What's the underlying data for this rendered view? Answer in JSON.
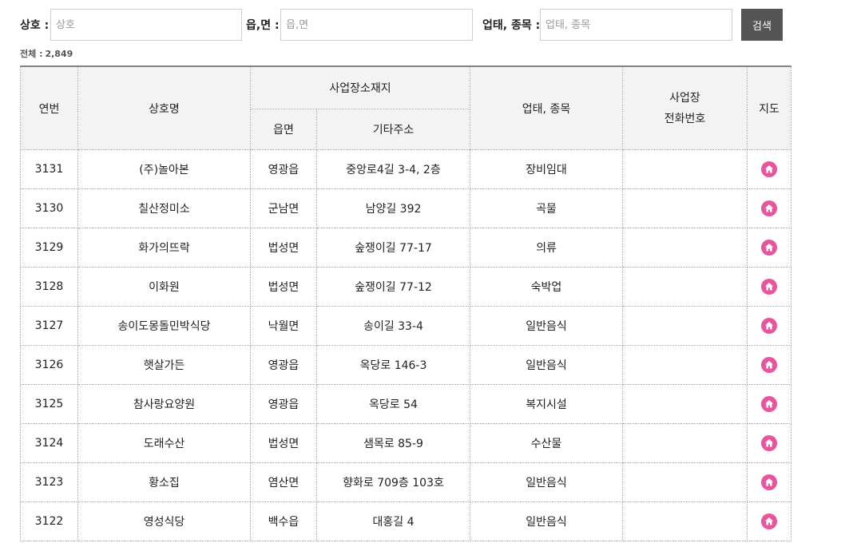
{
  "search": {
    "name_label": "상호 :",
    "name_placeholder": "상호",
    "town_label": "읍,면 :",
    "town_placeholder": "읍,면",
    "type_label": "업태, 종목 :",
    "type_placeholder": "업태, 종목",
    "button_label": "검색"
  },
  "total": {
    "label": "전체 :",
    "count": "2,849"
  },
  "table": {
    "headers": {
      "no": "연번",
      "name": "상호명",
      "location_group": "사업장소재지",
      "town": "읍면",
      "address": "기타주소",
      "type": "업태, 종목",
      "phone_line1": "사업장",
      "phone_line2": "전화번호",
      "map": "지도"
    },
    "rows": [
      {
        "no": "3131",
        "name": "(주)놀아본",
        "town": "영광읍",
        "address": "중앙로4길 3-4, 2층",
        "type": "장비임대",
        "phone": ""
      },
      {
        "no": "3130",
        "name": "칠산정미소",
        "town": "군남면",
        "address": "남양길 392",
        "type": "곡물",
        "phone": ""
      },
      {
        "no": "3129",
        "name": "화가의뜨락",
        "town": "법성면",
        "address": "숲쟁이길 77-17",
        "type": "의류",
        "phone": ""
      },
      {
        "no": "3128",
        "name": "이화원",
        "town": "법성면",
        "address": "숲쟁이길 77-12",
        "type": "숙박업",
        "phone": ""
      },
      {
        "no": "3127",
        "name": "송이도몽돌민박식당",
        "town": "낙월면",
        "address": "송이길 33-4",
        "type": "일반음식",
        "phone": ""
      },
      {
        "no": "3126",
        "name": "햇살가든",
        "town": "영광읍",
        "address": "옥당로 146-3",
        "type": "일반음식",
        "phone": ""
      },
      {
        "no": "3125",
        "name": "참사랑요양원",
        "town": "영광읍",
        "address": "옥당로 54",
        "type": "복지시설",
        "phone": ""
      },
      {
        "no": "3124",
        "name": "도래수산",
        "town": "법성면",
        "address": "샘목로 85-9",
        "type": "수산물",
        "phone": ""
      },
      {
        "no": "3123",
        "name": "황소집",
        "town": "염산면",
        "address": "향화로 709층 103호",
        "type": "일반음식",
        "phone": ""
      },
      {
        "no": "3122",
        "name": "영성식당",
        "town": "백수읍",
        "address": "대홍길 4",
        "type": "일반음식",
        "phone": ""
      }
    ]
  },
  "colors": {
    "map_icon": "#e8559c",
    "search_button": "#555555",
    "header_bg": "#f3f3f3"
  },
  "icons": {
    "map": "home-icon"
  }
}
